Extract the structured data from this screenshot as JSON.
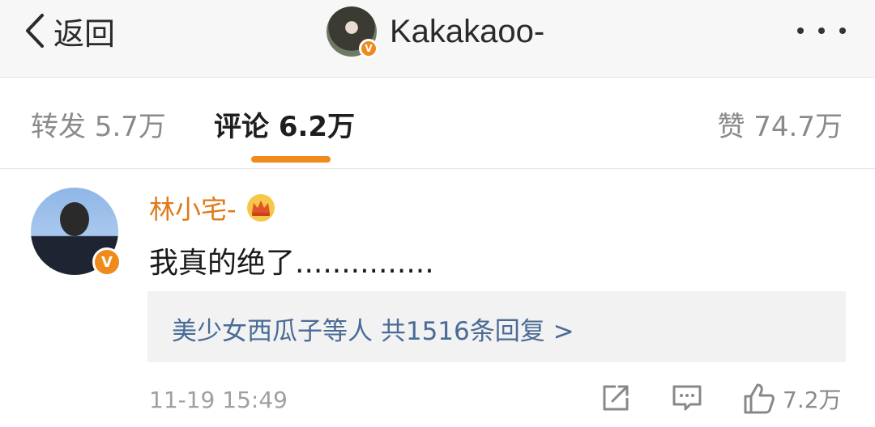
{
  "header": {
    "back_label": "返回",
    "title": "Kakakaoo-",
    "verified_mark": "V"
  },
  "tabs": {
    "repost": "转发 5.7万",
    "comment": "评论 6.2万",
    "like": "赞 74.7万",
    "active_color": "#f08a1c"
  },
  "comment": {
    "username": "林小宅-",
    "verified_mark": "V",
    "text": "我真的绝了...............",
    "replies": "美少女西瓜子等人  共1516条回复 >",
    "timestamp": "11-19 15:49",
    "like_count": "7.2万",
    "username_color": "#e07a18",
    "reply_link_color": "#4a6b96"
  },
  "icons": [
    "chevron-left-icon",
    "more-dots-icon",
    "crown-icon",
    "share-icon",
    "comment-icon",
    "thumbs-up-icon"
  ]
}
